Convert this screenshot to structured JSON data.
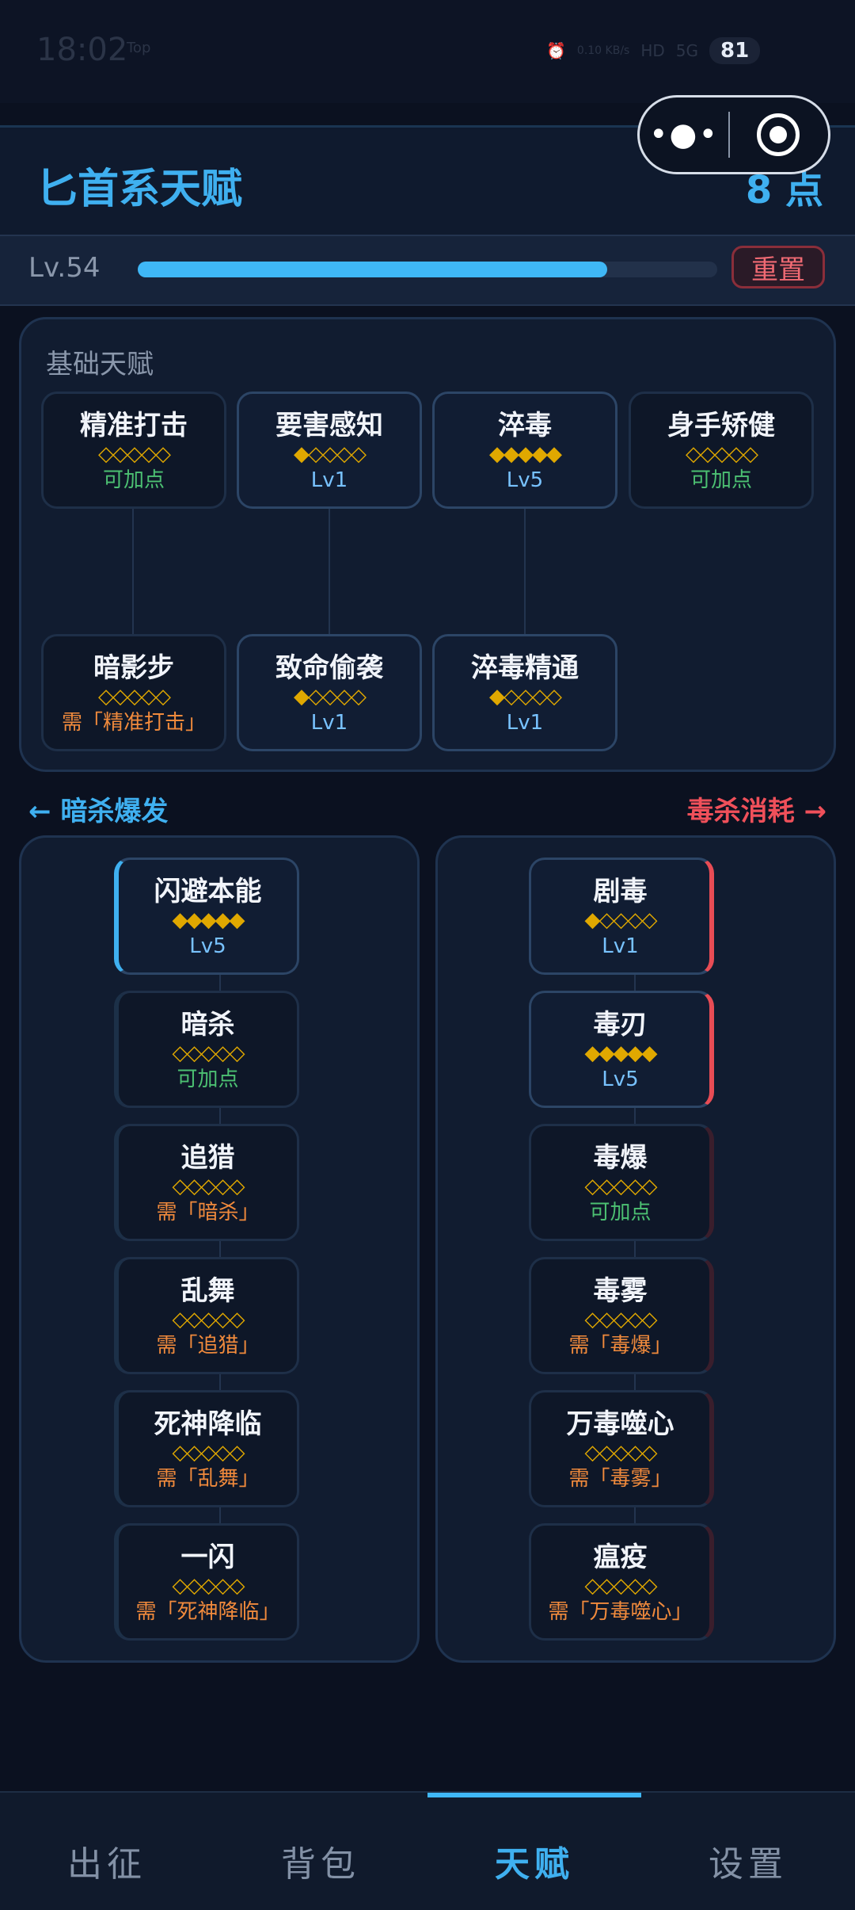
{
  "status_bar": {
    "time": "18:02",
    "weather": "Top",
    "network_speed": "0.10 KB/s",
    "hd": "HD",
    "signal": "5G",
    "battery": "81"
  },
  "header": {
    "title": "匕首系天赋",
    "points": "8 点"
  },
  "level_bar": {
    "level": "Lv.54",
    "progress": 0.81,
    "reset_label": "重置"
  },
  "basic": {
    "title": "基础天赋",
    "cards": [
      {
        "name": "精准打击",
        "stars": "◇◇◇◇◇",
        "status": "可加点",
        "status_type": "add"
      },
      {
        "name": "要害感知",
        "stars": "◆◇◇◇◇",
        "status": "Lv1",
        "status_type": "lv"
      },
      {
        "name": "淬毒",
        "stars": "◆◆◆◆◆",
        "status": "Lv5",
        "status_type": "lv"
      },
      {
        "name": "身手矫健",
        "stars": "◇◇◇◇◇",
        "status": "可加点",
        "status_type": "add"
      },
      {
        "name": "暗影步",
        "stars": "◇◇◇◇◇",
        "status": "需「精准打击」",
        "status_type": "req"
      },
      {
        "name": "致命偷袭",
        "stars": "◆◇◇◇◇",
        "status": "Lv1",
        "status_type": "lv"
      },
      {
        "name": "淬毒精通",
        "stars": "◆◇◇◇◇",
        "status": "Lv1",
        "status_type": "lv"
      }
    ]
  },
  "branches": {
    "left_label": "← 暗杀爆发",
    "right_label": "毒杀消耗 →",
    "left": [
      {
        "name": "闪避本能",
        "stars": "◆◆◆◆◆",
        "status": "Lv5",
        "status_type": "lv"
      },
      {
        "name": "暗杀",
        "stars": "◇◇◇◇◇",
        "status": "可加点",
        "status_type": "add"
      },
      {
        "name": "追猎",
        "stars": "◇◇◇◇◇",
        "status": "需「暗杀」",
        "status_type": "req"
      },
      {
        "name": "乱舞",
        "stars": "◇◇◇◇◇",
        "status": "需「追猎」",
        "status_type": "req"
      },
      {
        "name": "死神降临",
        "stars": "◇◇◇◇◇",
        "status": "需「乱舞」",
        "status_type": "req"
      },
      {
        "name": "一闪",
        "stars": "◇◇◇◇◇",
        "status": "需「死神降临」",
        "status_type": "req"
      }
    ],
    "right": [
      {
        "name": "剧毒",
        "stars": "◆◇◇◇◇",
        "status": "Lv1",
        "status_type": "lv"
      },
      {
        "name": "毒刃",
        "stars": "◆◆◆◆◆",
        "status": "Lv5",
        "status_type": "lv"
      },
      {
        "name": "毒爆",
        "stars": "◇◇◇◇◇",
        "status": "可加点",
        "status_type": "add"
      },
      {
        "name": "毒雾",
        "stars": "◇◇◇◇◇",
        "status": "需「毒爆」",
        "status_type": "req"
      },
      {
        "name": "万毒噬心",
        "stars": "◇◇◇◇◇",
        "status": "需「毒雾」",
        "status_type": "req"
      },
      {
        "name": "瘟疫",
        "stars": "◇◇◇◇◇",
        "status": "需「万毒噬心」",
        "status_type": "req"
      }
    ]
  },
  "tabs": [
    {
      "label": "出征",
      "active": false
    },
    {
      "label": "背包",
      "active": false
    },
    {
      "label": "天赋",
      "active": true
    },
    {
      "label": "设置",
      "active": false
    }
  ],
  "colors": {
    "accent_blue": "#3fb0f0",
    "accent_red": "#f0505a",
    "add_green": "#4cc072",
    "req_orange": "#f08a3c",
    "star_gold": "#e0a800"
  }
}
